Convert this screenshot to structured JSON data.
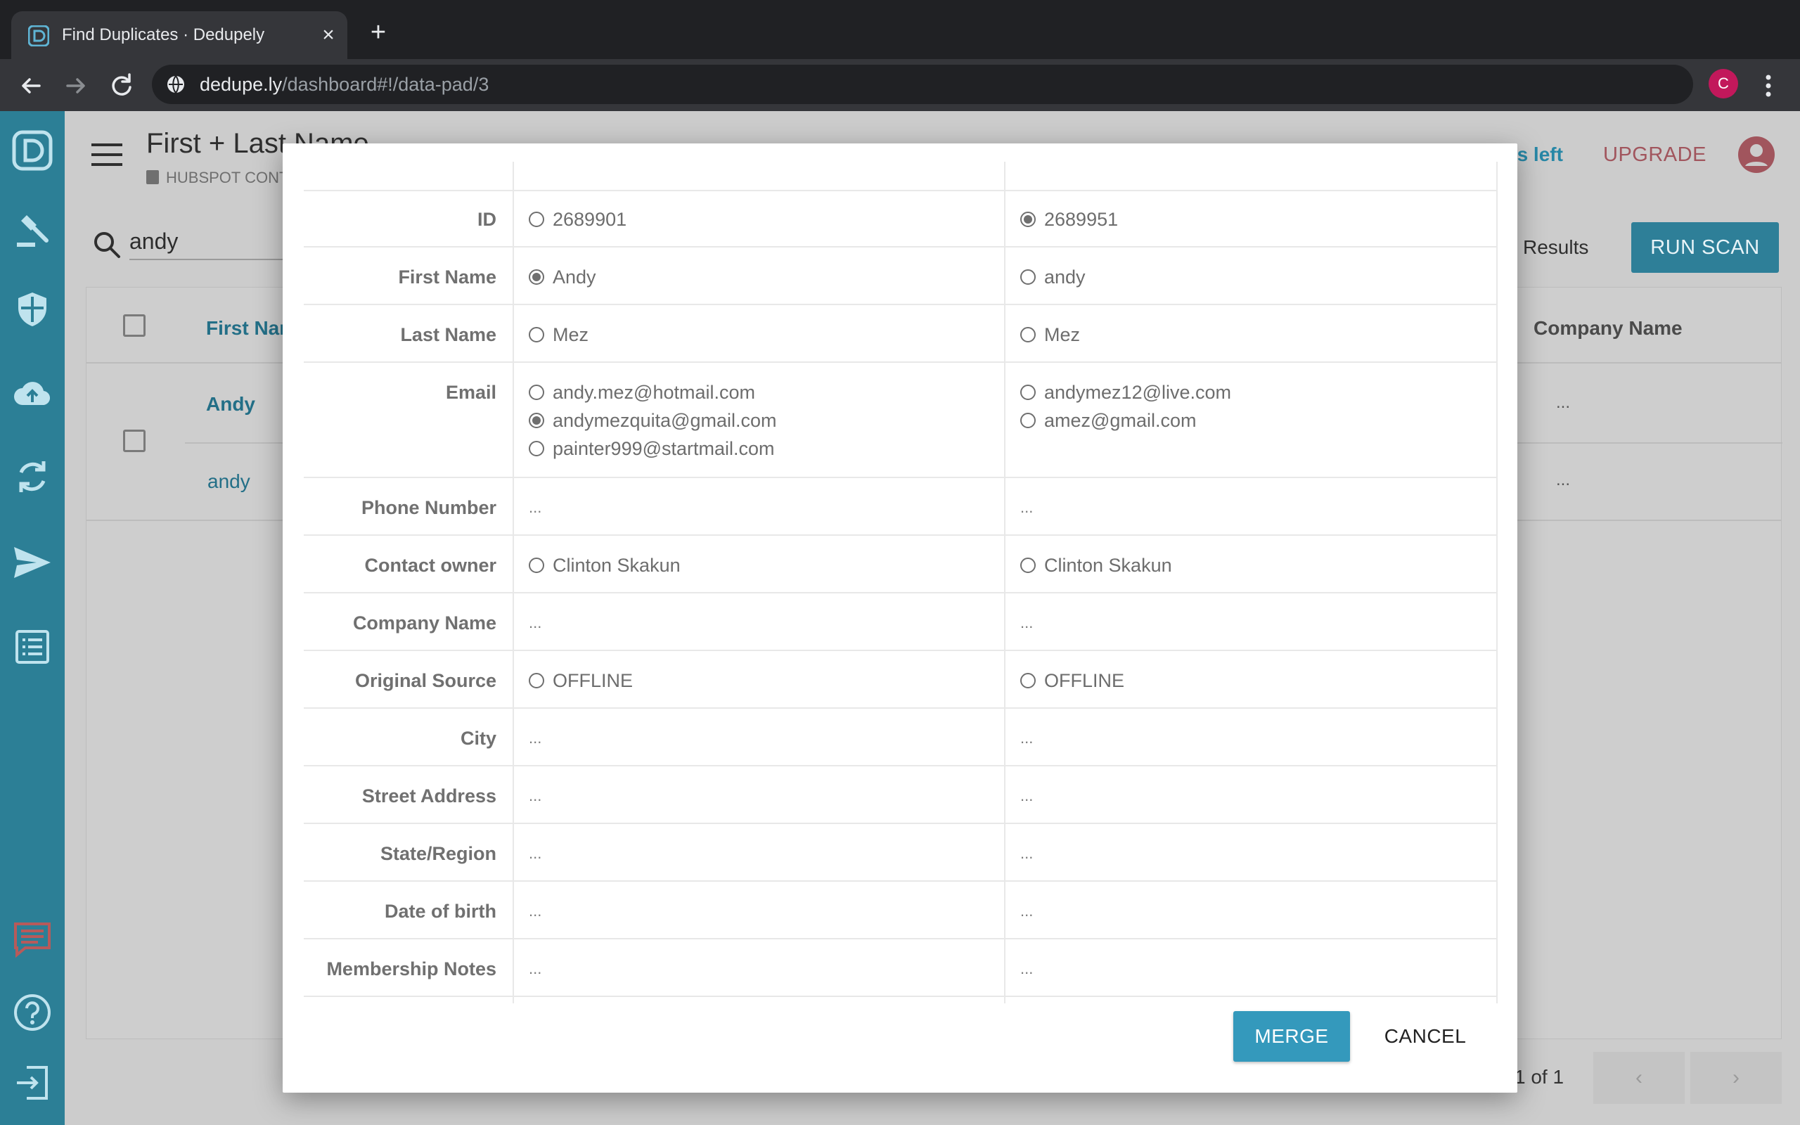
{
  "browser": {
    "tab_title": "Find Duplicates · Dedupely",
    "url_host": "dedupe.ly",
    "url_path": "/dashboard#!/data-pad/3",
    "profile_initial": "C"
  },
  "app": {
    "page_title": "First + Last Name",
    "page_subtitle": "HUBSPOT CONTACTS",
    "scans_left": "es left",
    "upgrade": "UPGRADE",
    "search_value": "andy",
    "results_label": "Results",
    "run_scan": "RUN SCAN",
    "columns": {
      "first_name": "First Name",
      "company_name": "Company Name"
    },
    "rows": [
      {
        "first_name": "Andy",
        "company": "..."
      },
      {
        "first_name": "andy",
        "company": "..."
      }
    ],
    "pager": {
      "text": "1 of 1",
      "prev": "‹",
      "next": "›"
    }
  },
  "modal": {
    "fields": [
      {
        "label": "ID",
        "left": [
          {
            "text": "2689901",
            "selected": false
          }
        ],
        "right": [
          {
            "text": "2689951",
            "selected": true
          }
        ]
      },
      {
        "label": "First Name",
        "left": [
          {
            "text": "Andy",
            "selected": true
          }
        ],
        "right": [
          {
            "text": "andy",
            "selected": false
          }
        ]
      },
      {
        "label": "Last Name",
        "left": [
          {
            "text": "Mez",
            "selected": false
          }
        ],
        "right": [
          {
            "text": "Mez",
            "selected": false
          }
        ]
      },
      {
        "label": "Email",
        "left": [
          {
            "text": "andy.mez@hotmail.com",
            "selected": false
          },
          {
            "text": "andymezquita@gmail.com",
            "selected": true
          },
          {
            "text": "painter999@startmail.com",
            "selected": false
          }
        ],
        "right": [
          {
            "text": "andymez12@live.com",
            "selected": false
          },
          {
            "text": "amez@gmail.com",
            "selected": false
          }
        ]
      },
      {
        "label": "Phone Number",
        "left_empty": "...",
        "right_empty": "..."
      },
      {
        "label": "Contact owner",
        "left": [
          {
            "text": "Clinton Skakun",
            "selected": false
          }
        ],
        "right": [
          {
            "text": "Clinton Skakun",
            "selected": false
          }
        ]
      },
      {
        "label": "Company Name",
        "left_empty": "...",
        "right_empty": "..."
      },
      {
        "label": "Original Source",
        "left": [
          {
            "text": "OFFLINE",
            "selected": false
          }
        ],
        "right": [
          {
            "text": "OFFLINE",
            "selected": false
          }
        ]
      },
      {
        "label": "City",
        "left_empty": "...",
        "right_empty": "..."
      },
      {
        "label": "Street Address",
        "left_empty": "...",
        "right_empty": "..."
      },
      {
        "label": "State/Region",
        "left_empty": "...",
        "right_empty": "..."
      },
      {
        "label": "Date of birth",
        "left_empty": "...",
        "right_empty": "..."
      },
      {
        "label": "Membership Notes",
        "left_empty": "...",
        "right_empty": "..."
      }
    ],
    "merge_button": "MERGE",
    "cancel_button": "CANCEL"
  }
}
